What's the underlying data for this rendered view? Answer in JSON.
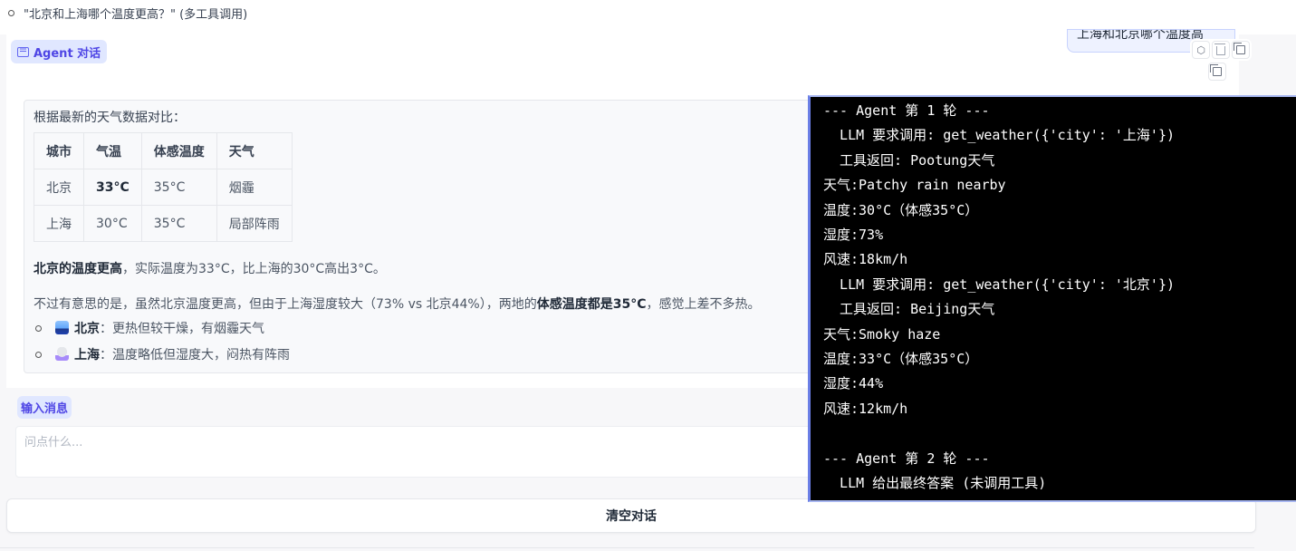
{
  "top_question": "\"北京和上海哪个温度更高？\" (多工具调用)",
  "chat": {
    "agent_label": "Agent 对话",
    "user_message": "上海和北京哪个温度高",
    "answer": {
      "intro": "根据最新的天气数据对比：",
      "table": {
        "headers": [
          "城市",
          "气温",
          "体感温度",
          "天气"
        ],
        "rows": [
          [
            "北京",
            "33°C",
            "35°C",
            "烟霾"
          ],
          [
            "上海",
            "30°C",
            "35°C",
            "局部阵雨"
          ]
        ]
      },
      "para1_bold": "北京的温度更高",
      "para1_rest": "，实际温度为33°C，比上海的30°C高出3°C。",
      "para2_start": "不过有意思的是，虽然北京温度更高，但由于上海湿度较大（73% vs 北京44%），两地的",
      "para2_bold": "体感温度都是35°C",
      "para2_end": "，感觉上差不多热。",
      "bullets": [
        {
          "icon": "city-icon",
          "city": "北京",
          "text": "：更热但较干燥，有烟霾天气"
        },
        {
          "icon": "rain-icon",
          "city": "上海",
          "text": "：温度略低但湿度大，闷热有阵雨"
        }
      ]
    }
  },
  "input": {
    "label": "输入消息",
    "placeholder": "问点什么..."
  },
  "clear_button": "清空对话",
  "terminal": {
    "lines": [
      "--- Agent 第 1 轮 ---",
      "  LLM 要求调用: get_weather({'city': '上海'})",
      "  工具返回: Pootung天气",
      "天气:Patchy rain nearby",
      "温度:30°C（体感35°C）",
      "湿度:73%",
      "风速:18km/h",
      "  LLM 要求调用: get_weather({'city': '北京'})",
      "  工具返回: Beijing天气",
      "天气:Smoky haze",
      "温度:33°C（体感35°C）",
      "湿度:44%",
      "风速:12km/h",
      "",
      "--- Agent 第 2 轮 ---",
      "  LLM 给出最终答案 (未调用工具)"
    ]
  },
  "colors": {
    "accent": "#4f46e5",
    "pill_bg": "#e0e7ff",
    "terminal_bg": "#000000"
  }
}
